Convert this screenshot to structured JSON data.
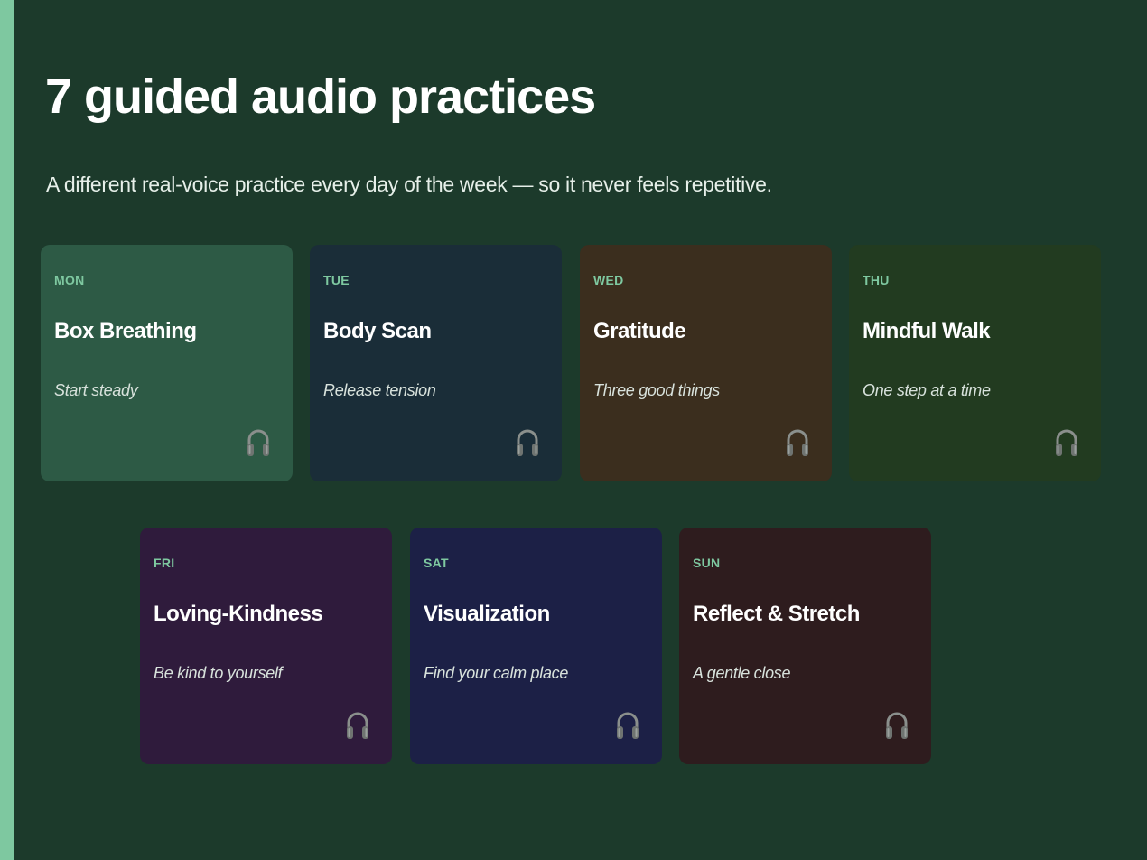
{
  "header": {
    "title": "7 guided audio practices",
    "subtitle": "A different real-voice practice every day of the week — so it never feels repetitive."
  },
  "colors": {
    "background": "#1c3a2b",
    "accent": "#7ec8a0"
  },
  "practices": [
    {
      "day": "MON",
      "title": "Box Breathing",
      "tagline": "Start steady",
      "icon": "headphones-icon",
      "color": "#2d5a45"
    },
    {
      "day": "TUE",
      "title": "Body Scan",
      "tagline": "Release tension",
      "icon": "headphones-icon",
      "color": "#1a2d38"
    },
    {
      "day": "WED",
      "title": "Gratitude",
      "tagline": "Three good things",
      "icon": "headphones-icon",
      "color": "#3b2e1e"
    },
    {
      "day": "THU",
      "title": "Mindful Walk",
      "tagline": "One step at a time",
      "icon": "headphones-icon",
      "color": "#223b20"
    },
    {
      "day": "FRI",
      "title": "Loving-Kindness",
      "tagline": "Be kind to yourself",
      "icon": "headphones-icon",
      "color": "#2f1b3c"
    },
    {
      "day": "SAT",
      "title": "Visualization",
      "tagline": "Find your calm place",
      "icon": "headphones-icon",
      "color": "#1c2046"
    },
    {
      "day": "SUN",
      "title": "Reflect & Stretch",
      "tagline": "A gentle close",
      "icon": "headphones-icon",
      "color": "#2e1c1e"
    }
  ]
}
